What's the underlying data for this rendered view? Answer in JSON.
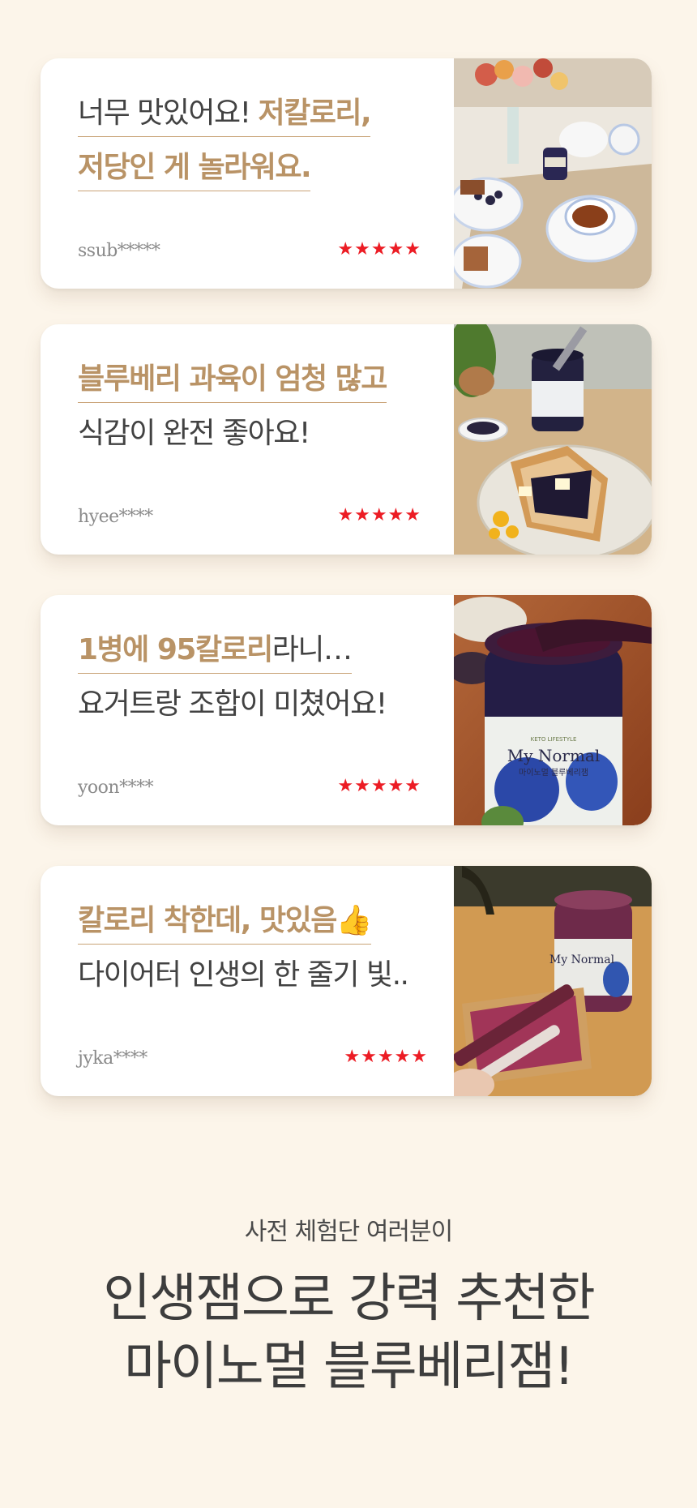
{
  "reviews": [
    {
      "lines": [
        [
          {
            "text": "너무 맛있어요! ",
            "style": "dark"
          },
          {
            "text": "저칼로리,",
            "style": "gold",
            "underline": true
          }
        ],
        [
          {
            "text": "저당인 게 놀라워요.",
            "style": "gold",
            "underline": true
          }
        ]
      ],
      "reviewer": "ssub*****",
      "stars": "★★★★★",
      "photo_icon": "tea-table-photo"
    },
    {
      "lines": [
        [
          {
            "text": "블루베리 과육이 엄청 많고",
            "style": "gold",
            "underline": true
          }
        ],
        [
          {
            "text": "식감이 완전 좋아요!",
            "style": "dark"
          }
        ]
      ],
      "reviewer": "hyee****",
      "stars": "★★★★★",
      "photo_icon": "jam-toast-photo"
    },
    {
      "lines": [
        [
          {
            "text": "1병에 95칼로리",
            "style": "gold",
            "underline": true
          },
          {
            "text": "라니…",
            "style": "dark",
            "underline": true
          }
        ],
        [
          {
            "text": "요거트랑 조합이 미쳤어요!",
            "style": "dark"
          }
        ]
      ],
      "reviewer": "yoon****",
      "stars": "★★★★★",
      "photo_icon": "open-jar-photo"
    },
    {
      "lines": [
        [
          {
            "text": "칼로리 착한데, 맛있음👍",
            "style": "gold",
            "underline": true
          }
        ],
        [
          {
            "text": "다이어터 인생의 한 줄기 빛..",
            "style": "dark"
          }
        ]
      ],
      "reviewer": "jyka****",
      "stars": "★★★★★",
      "photo_icon": "jam-cracker-photo"
    }
  ],
  "product_label": {
    "top": "KETO LIFESTYLE",
    "brand": "My Normal",
    "name": "마이노멀 블루베리잼"
  },
  "footer": {
    "subtitle": "사전 체험단 여러분이",
    "title_line1": "인생잼으로 강력 추천한",
    "title_line2": "마이노멀 블루베리잼!"
  },
  "colors": {
    "background": "#fcf5ea",
    "accent_gold": "#b99366",
    "star_red": "#ec1c24",
    "text_dark": "#424242"
  }
}
